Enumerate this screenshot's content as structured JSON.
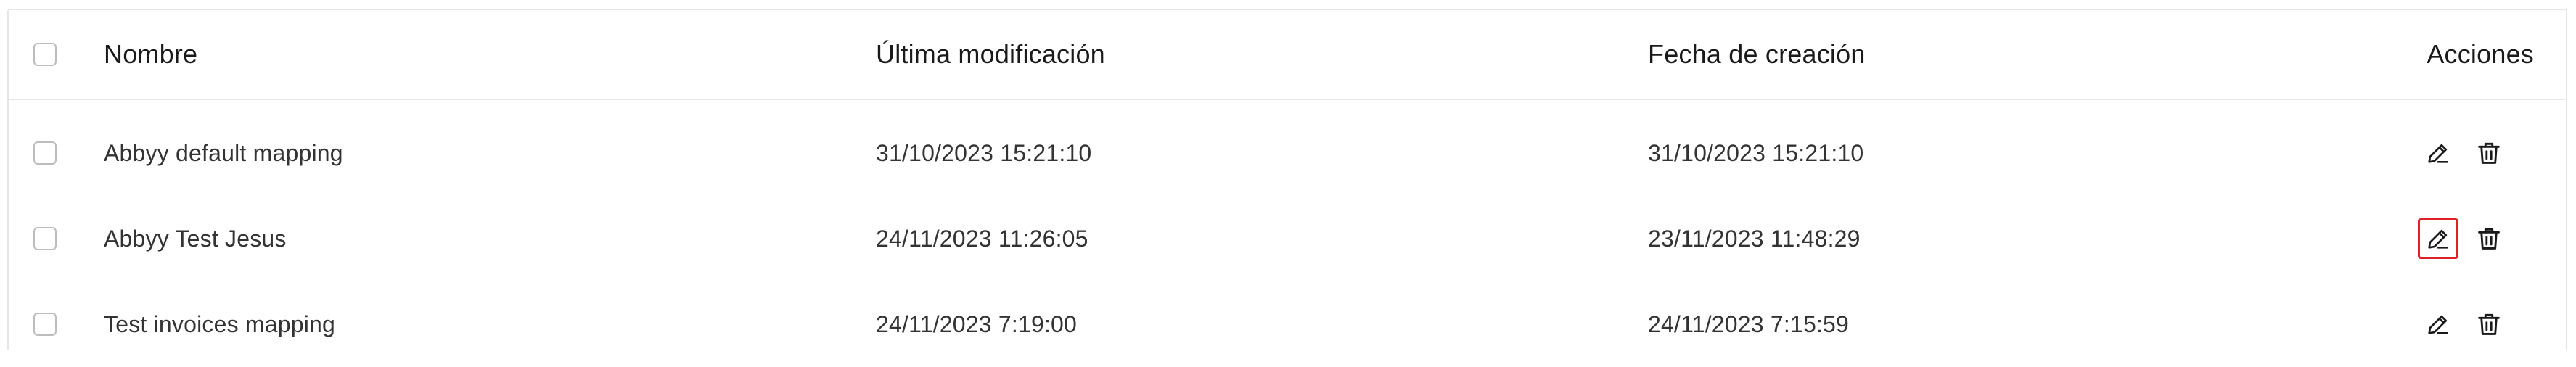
{
  "table": {
    "columns": {
      "name": "Nombre",
      "modified": "Última modificación",
      "created": "Fecha de creación",
      "actions": "Acciones"
    },
    "rows": [
      {
        "name": "Abbyy default mapping",
        "modified": "31/10/2023 15:21:10",
        "created": "31/10/2023 15:21:10",
        "edit_icon": "pencil-icon",
        "delete_icon": "trash-icon",
        "edit_highlighted": false
      },
      {
        "name": "Abbyy Test Jesus",
        "modified": "24/11/2023 11:26:05",
        "created": "23/11/2023 11:48:29",
        "edit_icon": "pencil-icon",
        "delete_icon": "trash-icon",
        "edit_highlighted": true
      },
      {
        "name": "Test invoices mapping",
        "modified": "24/11/2023 7:19:00",
        "created": "24/11/2023 7:15:59",
        "edit_icon": "pencil-icon",
        "delete_icon": "trash-icon",
        "edit_highlighted": false
      }
    ]
  },
  "colors": {
    "border": "#e5e5e5",
    "highlight": "#e0202a",
    "text": "#333333"
  }
}
